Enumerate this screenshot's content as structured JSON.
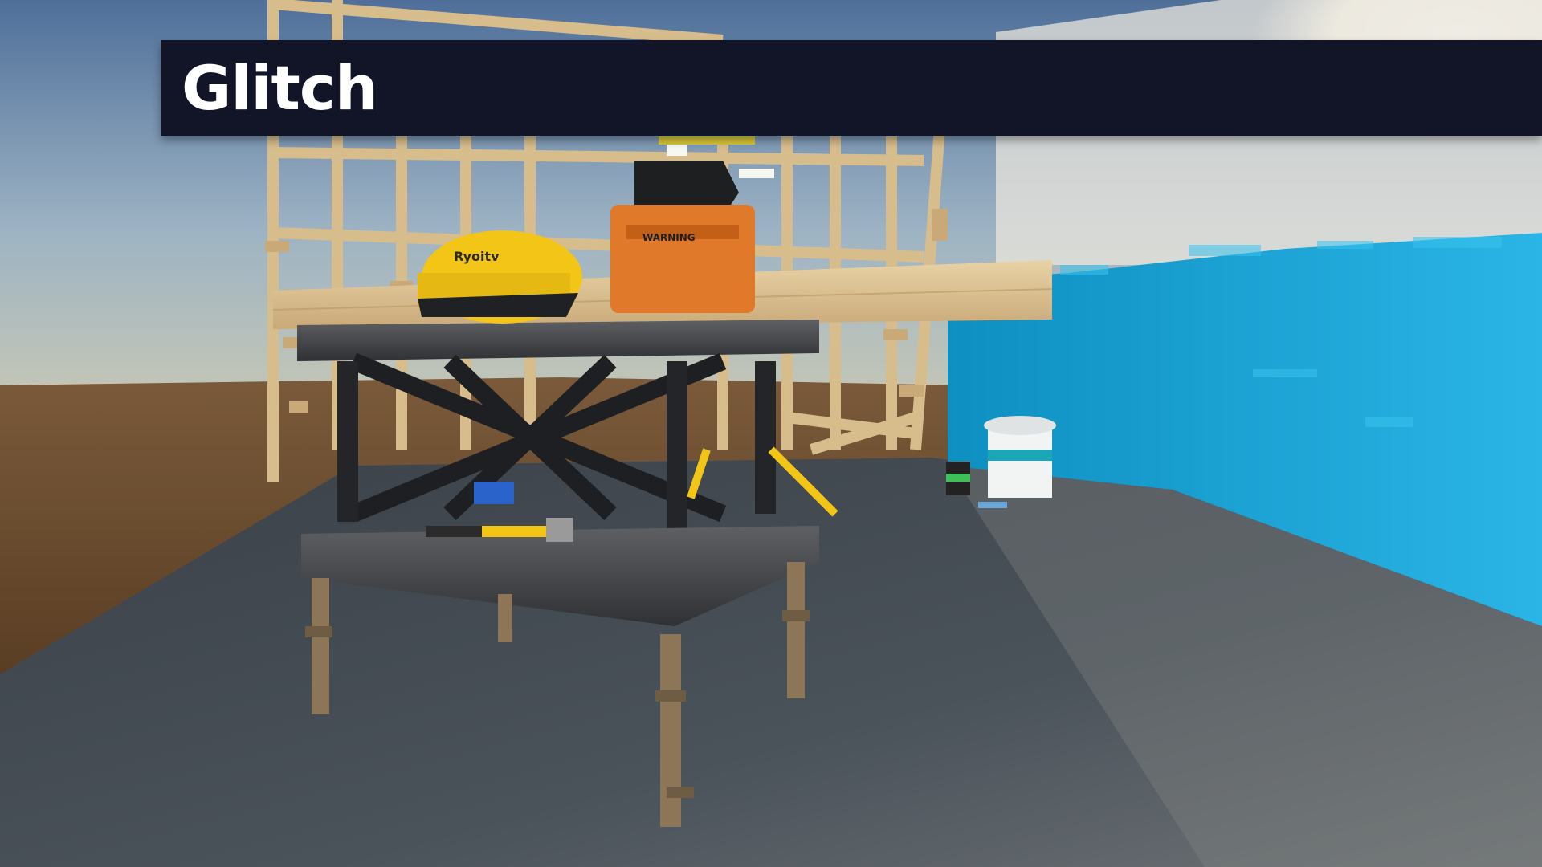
{
  "overlay": {
    "title": "Glitch"
  },
  "scene": {
    "description_icons": [
      "construction-scene",
      "workbench",
      "hard-hat",
      "jigsaw",
      "hammer",
      "paint-bucket"
    ],
    "helmet_brand": "Ryoitv",
    "jigsaw_label": "WARNING"
  },
  "colors": {
    "title_bar_bg": "#121527",
    "title_text": "#ffffff",
    "wall_cyan": "#1aa6d6",
    "helmet_yellow": "#f2c516",
    "jigsaw_orange": "#e0792a"
  }
}
